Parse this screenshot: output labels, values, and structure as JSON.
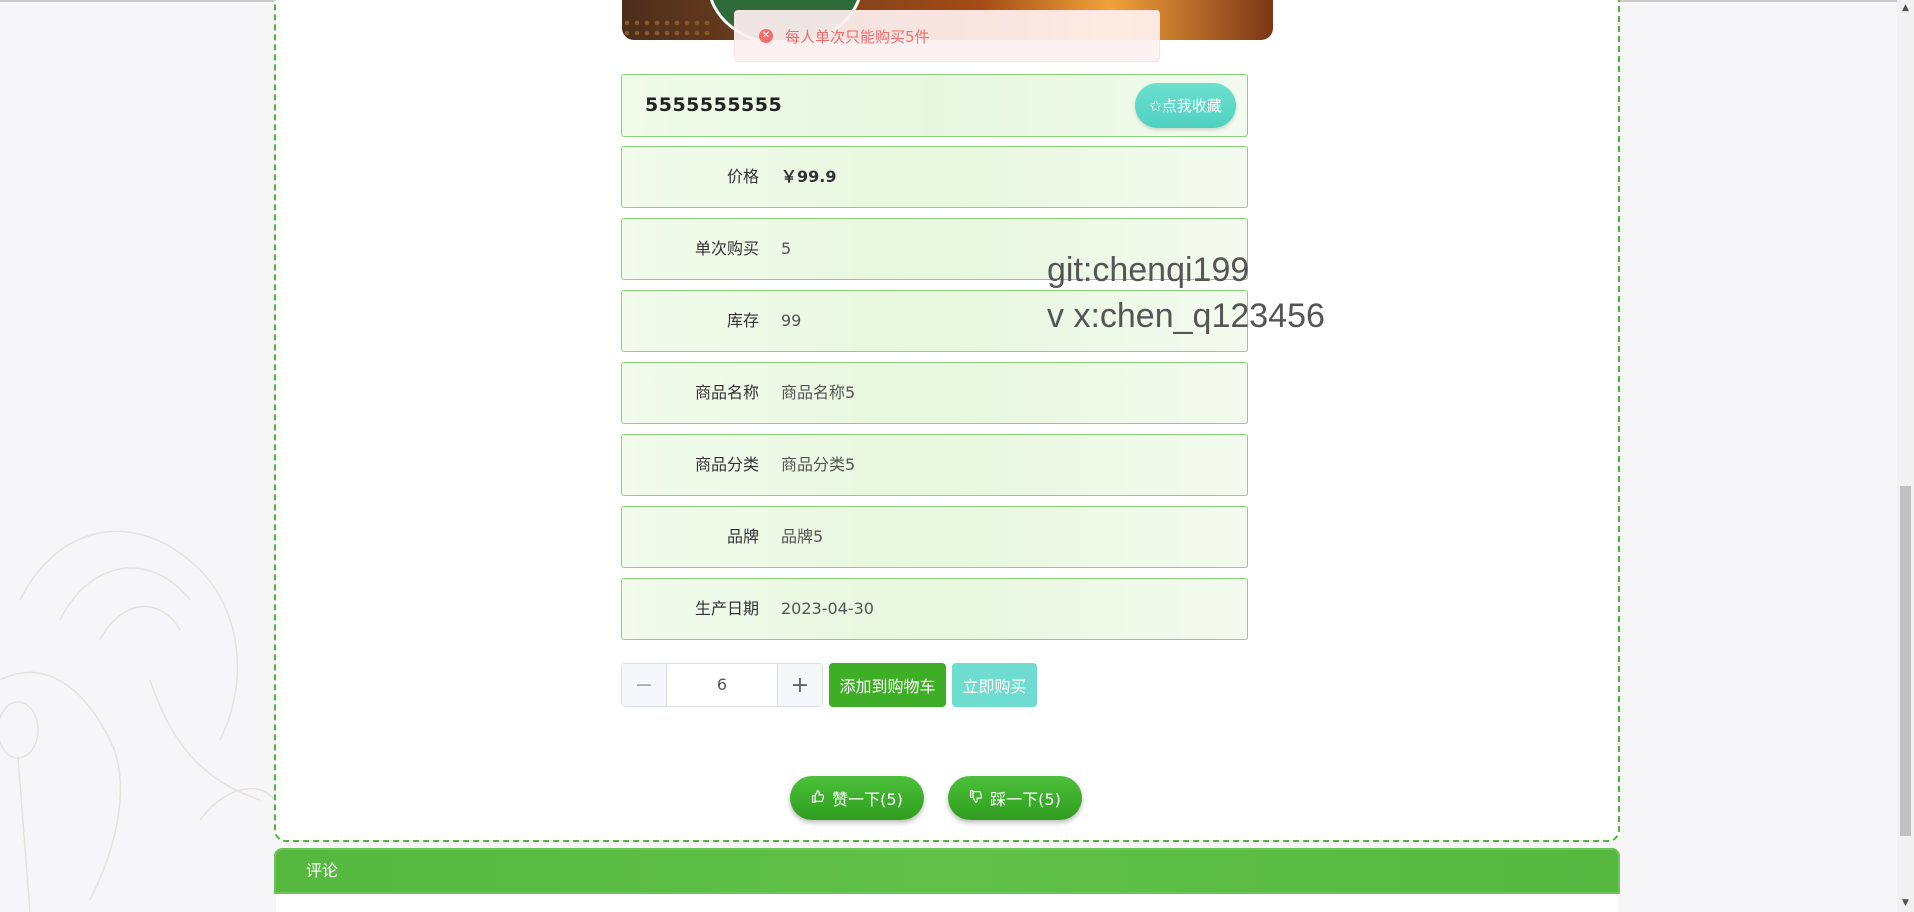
{
  "toast": {
    "message": "每人单次只能购买5件",
    "icon": "error-circle-icon"
  },
  "product": {
    "title": "5555555555",
    "favorite_label": "✩点我收藏",
    "fields": [
      {
        "label": "价格",
        "value": "￥99.9"
      },
      {
        "label": "单次购买",
        "value": "5"
      },
      {
        "label": "库存",
        "value": "99"
      },
      {
        "label": "商品名称",
        "value": "商品名称5"
      },
      {
        "label": "商品分类",
        "value": "商品分类5"
      },
      {
        "label": "品牌",
        "value": "品牌5"
      },
      {
        "label": "生产日期",
        "value": "2023-04-30"
      }
    ]
  },
  "quantity": {
    "value": "6",
    "minus": "−",
    "plus": "+"
  },
  "actions": {
    "add_to_cart": "添加到购物车",
    "buy_now": "立即购买"
  },
  "votes": {
    "like": "赞一下(5)",
    "dislike": "踩一下(5)",
    "like_icon": "thumb-up-icon",
    "dislike_icon": "thumb-down-icon"
  },
  "watermark": {
    "line1": "git:chenqi199",
    "line2": "v x:chen_q123456"
  },
  "comments": {
    "header": "评论"
  },
  "colors": {
    "primary": "#3fae27",
    "accent": "#6fdcd0",
    "error": "#f56c6c"
  }
}
